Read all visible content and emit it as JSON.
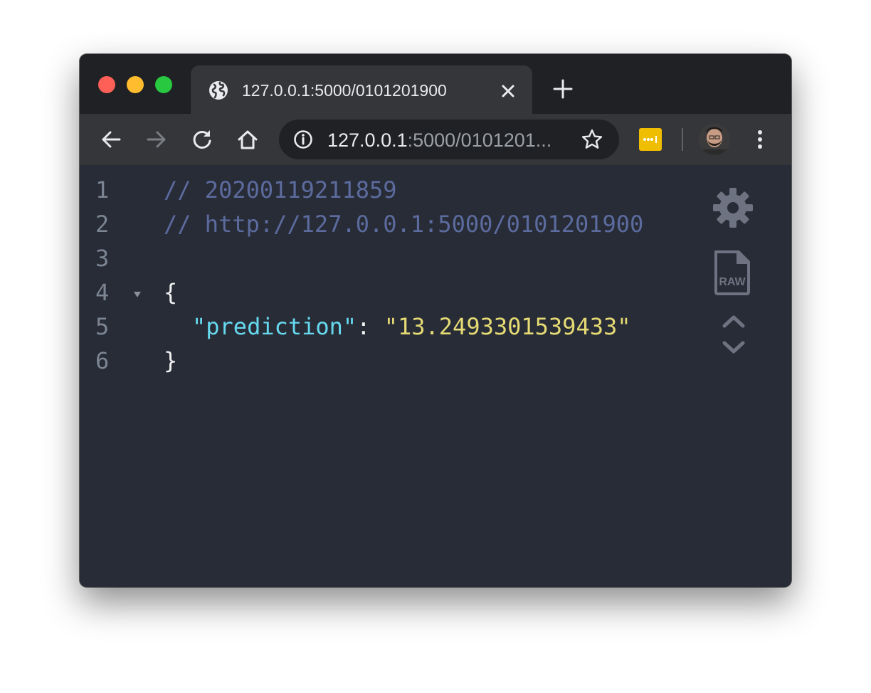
{
  "tab": {
    "title": "127.0.0.1:5000/0101201900"
  },
  "address_bar": {
    "host": "127.0.0.1",
    "path_truncated": ":5000/0101201..."
  },
  "icons": {
    "tab_favicon": "globe-icon",
    "tab_close": "close-icon",
    "new_tab": "plus-icon",
    "back": "arrow-left-icon",
    "forward": "arrow-right-icon",
    "reload": "reload-icon",
    "home": "home-icon",
    "site_info": "info-icon",
    "bookmark": "star-icon",
    "extension": "lastpass-icon",
    "profile": "avatar",
    "menu": "more-vertical-icon",
    "settings": "gear-icon",
    "raw": "raw-file-icon",
    "collapse": "chevron-up-icon",
    "expand": "chevron-down-icon"
  },
  "json_viewer": {
    "line_numbers": [
      "1",
      "2",
      "3",
      "4",
      "5",
      "6"
    ],
    "comment_1": "// 20200119211859",
    "comment_2": "// http://127.0.0.1:5000/0101201900",
    "open_brace": "{",
    "key": "\"prediction\"",
    "colon": ": ",
    "value": "\"13.2493301539433\"",
    "close_brace": "}",
    "raw_label": "RAW"
  },
  "colors": {
    "traffic_close": "#fe5f57",
    "traffic_minimize": "#febc2e",
    "traffic_maximize": "#28c840",
    "comment": "#5c6b9e",
    "key": "#66d9ef",
    "string": "#e6db74",
    "background": "#282c37",
    "extension": "#f0be00"
  }
}
